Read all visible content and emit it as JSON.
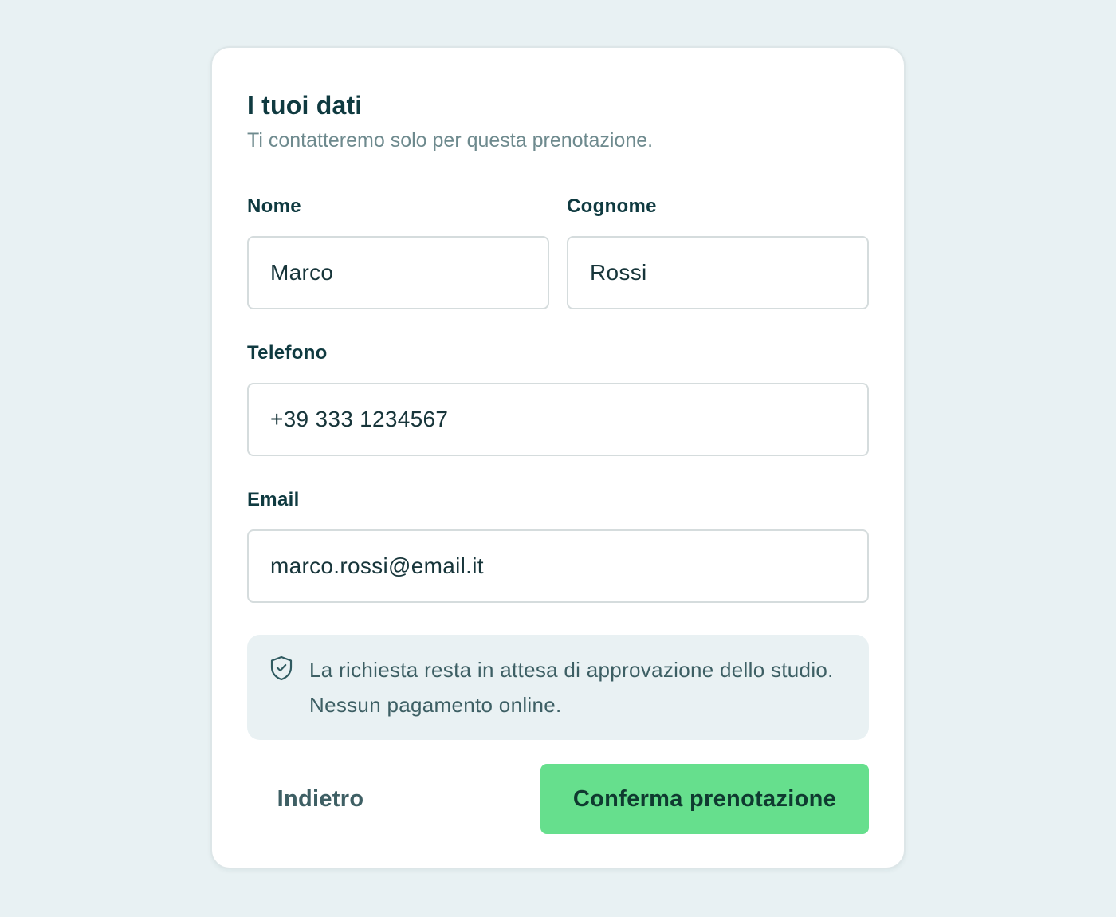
{
  "form": {
    "title": "I tuoi dati",
    "subtitle": "Ti contatteremo solo per questa prenotazione.",
    "fields": {
      "first_name": {
        "label": "Nome",
        "value": "Marco"
      },
      "last_name": {
        "label": "Cognome",
        "value": "Rossi"
      },
      "phone": {
        "label": "Telefono",
        "value": "+39 333 1234567"
      },
      "email": {
        "label": "Email",
        "value": "marco.rossi@email.it"
      }
    },
    "notice": {
      "icon": "shield-check-icon",
      "text": "La richiesta resta in attesa di approvazione dello studio. Nessun pagamento online."
    },
    "actions": {
      "back_label": "Indietro",
      "confirm_label": "Conferma prenotazione"
    }
  },
  "colors": {
    "background": "#e8f1f3",
    "card": "#ffffff",
    "text_primary": "#0f3a40",
    "text_muted": "#6e8a8e",
    "notice_bg": "#e9f1f3",
    "accent": "#66df8d"
  }
}
